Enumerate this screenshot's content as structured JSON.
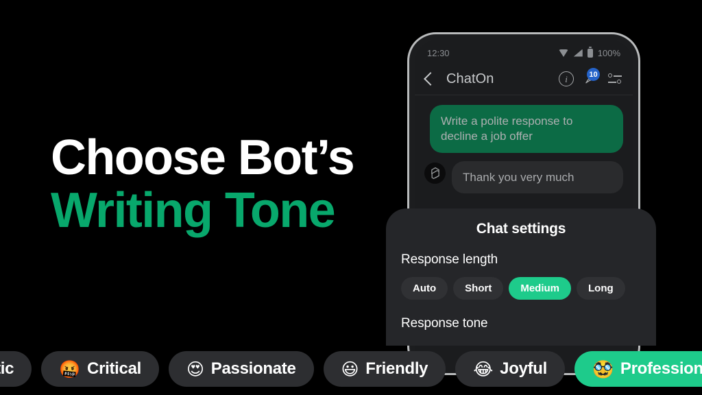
{
  "headline": {
    "line1": "Choose Bot’s",
    "line2": "Writing Tone",
    "accent_color": "#08A86C"
  },
  "phone": {
    "status_bar": {
      "time": "12:30",
      "battery_percent": "100%",
      "icons": [
        "wifi-icon",
        "cellular-signal-icon",
        "battery-icon"
      ]
    },
    "chat_header": {
      "back_icon": "back-chevron-icon",
      "title": "ChatOn",
      "info_icon": "info-icon",
      "pin_icon": "pin-icon",
      "pin_badge_count": "10",
      "tune_icon": "tune-icon"
    },
    "messages": [
      {
        "role": "user",
        "text": "Write a polite response to decline a job offer"
      },
      {
        "role": "bot",
        "avatar": "bot-logo-icon",
        "text": "Thank you very much"
      }
    ]
  },
  "sheet": {
    "title": "Chat settings",
    "response_length": {
      "label": "Response length",
      "options": [
        "Auto",
        "Short",
        "Medium",
        "Long"
      ],
      "selected": "Medium",
      "selected_color": "#1ECB8B"
    },
    "response_tone": {
      "label": "Response tone"
    }
  },
  "tone_strip": {
    "chips": [
      {
        "emoji": "",
        "label": "thetic",
        "selected": false
      },
      {
        "emoji": "🤬",
        "label": "Critical",
        "selected": false
      },
      {
        "emoji": "😍",
        "label": "Passionate",
        "selected": false
      },
      {
        "emoji": "😃",
        "label": "Friendly",
        "selected": false
      },
      {
        "emoji": "😂",
        "label": "Joyful",
        "selected": false
      },
      {
        "emoji": "🥸",
        "label": "Professional",
        "selected": true
      }
    ],
    "selected_color": "#1ECB8B"
  }
}
